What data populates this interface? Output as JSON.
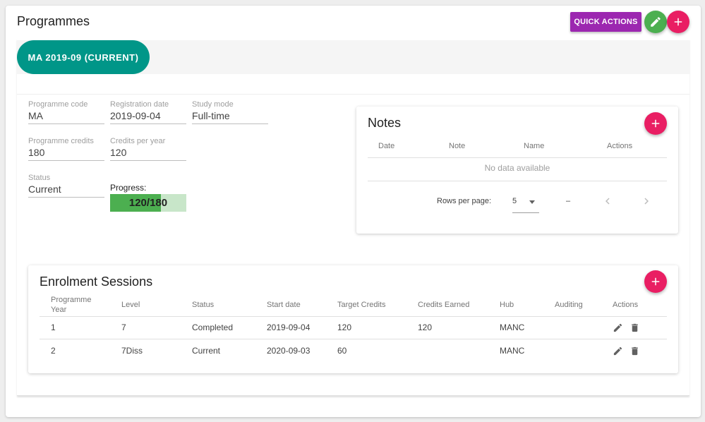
{
  "header": {
    "title": "Programmes",
    "quick_actions_label": "QUICK ACTIONS",
    "edit_icon": "pencil-icon",
    "add_icon": "plus-icon"
  },
  "tabs": [
    {
      "label": "MA 2019-09 (CURRENT)",
      "active": true
    }
  ],
  "programme": {
    "code": {
      "label": "Programme code",
      "value": "MA"
    },
    "registration_date": {
      "label": "Registration date",
      "value": "2019-09-04"
    },
    "study_mode": {
      "label": "Study mode",
      "value": "Full-time"
    },
    "credits": {
      "label": "Programme credits",
      "value": "180"
    },
    "credits_per_year": {
      "label": "Credits per year",
      "value": "120"
    },
    "status": {
      "label": "Status",
      "value": "Current"
    },
    "progress": {
      "label": "Progress:",
      "text": "120/180",
      "earned": 120,
      "total": 180
    }
  },
  "notes": {
    "title": "Notes",
    "columns": [
      "Date",
      "Note",
      "Name",
      "Actions"
    ],
    "empty_text": "No data available",
    "rows_per_page_label": "Rows per page:",
    "rows_per_page_value": "5",
    "page_range": "–"
  },
  "enrolment": {
    "title": "Enrolment Sessions",
    "columns": [
      "Programme Year",
      "Level",
      "Status",
      "Start date",
      "Target Credits",
      "Credits Earned",
      "Hub",
      "Auditing",
      "Actions"
    ],
    "rows": [
      {
        "year": "1",
        "level": "7",
        "status": "Completed",
        "start": "2019-09-04",
        "target": "120",
        "earned": "120",
        "hub": "MANC",
        "auditing": ""
      },
      {
        "year": "2",
        "level": "7Diss",
        "status": "Current",
        "start": "2020-09-03",
        "target": "60",
        "earned": "",
        "hub": "MANC",
        "auditing": ""
      }
    ]
  },
  "colors": {
    "tab_active": "#009688",
    "quick_actions": "#9c27b0",
    "fab_add": "#e91e63",
    "fab_edit": "#4caf50",
    "progress_fill": "#4caf50",
    "progress_track": "#c8e6c9"
  }
}
